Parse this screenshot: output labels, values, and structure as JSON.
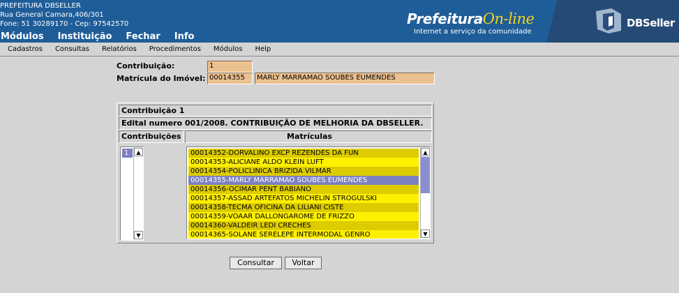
{
  "institution": {
    "name": "PREFEITURA DBSELLER",
    "address": "Rua General Camara,406/301",
    "phone_line": "Fone: 51 30289170  -  Cep: 97542570"
  },
  "main_menu": [
    "Módulos",
    "Instituição",
    "Fechar",
    "Info"
  ],
  "logo": {
    "prefeitura": "Prefeitura",
    "online": "On-line",
    "tagline": "Internet a serviço da comunidade",
    "dbseller": "DBSeller"
  },
  "sub_menu": [
    "Cadastros",
    "Consultas",
    "Relatórios",
    "Procedimentos",
    "Módulos",
    "Help"
  ],
  "form": {
    "contribuicao_label": "Contribuição:",
    "contribuicao_value": "1",
    "matricula_label": "Matrícula do Imóvel:",
    "matricula_value": "00014355",
    "matricula_name": "MARLY MARRAMAO SOUBES EUMENDES"
  },
  "panel": {
    "title": "Contribuição 1",
    "edital": "Edital numero 001/2008. CONTRIBUIÇÃO DE MELHORIA DA DBSELLER.",
    "col_contribuicoes": "Contribuições",
    "col_matriculas": "Matrículas",
    "contribuicoes": [
      "1"
    ],
    "matriculas": [
      "00014352-DORVALINO EXCP REZENDES DA FUN",
      "00014353-ALICIANE ALDO KLEIN LUFT",
      "00014354-POLICLINICA BRIZIDA VILMAR",
      "00014355-MARLY MARRAMAO SOUBES EUMENDES",
      "00014356-OCIMAR PENT BABIANO",
      "00014357-ASSAD ARTEFATOS MICHELIN STROGULSKI",
      "00014358-TECMA OFICINA DA LILIANI CISTE",
      "00014359-VOAAR DALLONGAROME DE FRIZZO",
      "00014360-VALDEIR LEDI CRECHES",
      "00014365-SOLANE SERELEPE INTERMODAL GENRO"
    ],
    "selected_index": 3
  },
  "buttons": {
    "consultar": "Consultar",
    "voltar": "Voltar"
  },
  "colors": {
    "header_bg": "#1f5d98",
    "field_bg": "#ecc190",
    "row_even": "#dccc00",
    "row_odd": "#fff000",
    "row_selected": "#7c80c0"
  }
}
